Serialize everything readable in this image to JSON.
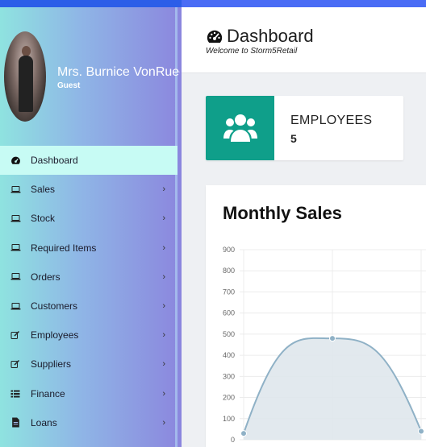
{
  "user": {
    "name": "Mrs. Burnice VonRueden",
    "role": "Guest"
  },
  "menu": [
    {
      "label": "Dashboard",
      "icon": "tachometer-icon",
      "active": true,
      "chevron": false
    },
    {
      "label": "Sales",
      "icon": "laptop-icon",
      "chevron": true
    },
    {
      "label": "Stock",
      "icon": "laptop-icon",
      "chevron": true
    },
    {
      "label": "Required Items",
      "icon": "laptop-icon",
      "chevron": true
    },
    {
      "label": "Orders",
      "icon": "laptop-icon",
      "chevron": true
    },
    {
      "label": "Customers",
      "icon": "laptop-icon",
      "chevron": true
    },
    {
      "label": "Employees",
      "icon": "edit-icon",
      "chevron": true
    },
    {
      "label": "Suppliers",
      "icon": "edit-icon",
      "chevron": true
    },
    {
      "label": "Finance",
      "icon": "list-icon",
      "chevron": true
    },
    {
      "label": "Loans",
      "icon": "file-icon",
      "chevron": true
    }
  ],
  "header": {
    "title": "Dashboard",
    "subtitle": "Welcome to Storm5Retail"
  },
  "stat": {
    "label": "EMPLOYEES",
    "value": "5"
  },
  "colors": {
    "accent": "#0f9f8a",
    "sidebar_active": "#c7fbf4",
    "line": "#8fb1c6",
    "fill": "#dfe7ec"
  },
  "chart_data": {
    "type": "line",
    "title": "Monthly Sales",
    "y_ticks": [
      0,
      100,
      200,
      300,
      400,
      500,
      600,
      700,
      800,
      900
    ],
    "ylim": [
      0,
      900
    ],
    "x": [
      0,
      1,
      2
    ],
    "values": [
      30,
      480,
      40
    ],
    "smooth": true,
    "filled": true,
    "grid": true
  }
}
